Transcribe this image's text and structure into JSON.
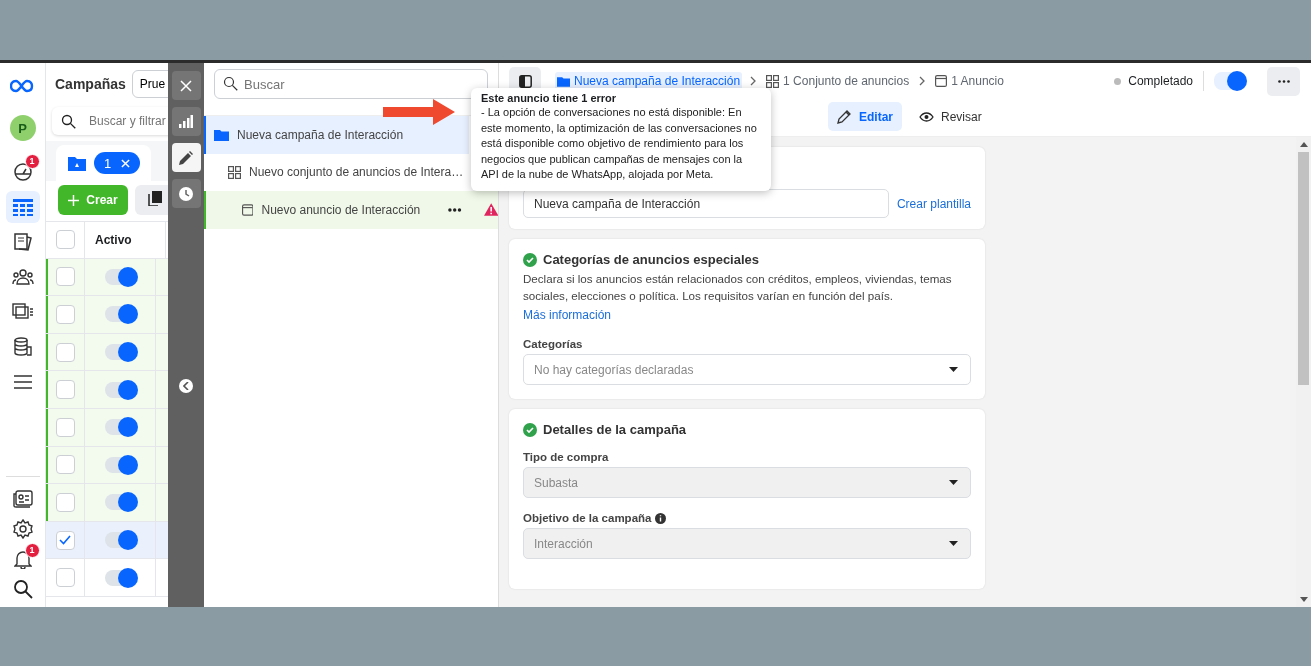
{
  "nav": {
    "avatar": "P",
    "items": [
      {
        "selected": false,
        "badge": "1"
      },
      {
        "selected": true
      },
      {
        "selected": false
      },
      {
        "selected": false
      },
      {
        "selected": false
      },
      {
        "selected": false
      },
      {
        "selected": false
      }
    ],
    "notifications_badge": "1"
  },
  "campaigns": {
    "title": "Campañas",
    "account_button": "Prue",
    "search_placeholder": "Buscar y filtrar",
    "filter_count": "1",
    "create_button": "Crear",
    "column": "Activo",
    "header_checked": false,
    "rows": [
      {
        "checked": false,
        "on": true,
        "highlighted": true
      },
      {
        "checked": false,
        "on": true,
        "highlighted": true
      },
      {
        "checked": false,
        "on": true,
        "highlighted": true
      },
      {
        "checked": false,
        "on": true,
        "highlighted": true
      },
      {
        "checked": false,
        "on": true,
        "highlighted": true
      },
      {
        "checked": false,
        "on": true,
        "highlighted": true
      },
      {
        "checked": false,
        "on": true,
        "highlighted": true
      },
      {
        "checked": true,
        "on": true,
        "highlighted": false
      },
      {
        "checked": false,
        "on": true,
        "highlighted": false
      }
    ]
  },
  "tools": [
    {
      "kind": "chart",
      "selected": false
    },
    {
      "kind": "edit",
      "selected": true
    },
    {
      "kind": "history",
      "selected": false
    }
  ],
  "tree": {
    "search_placeholder": "Buscar",
    "items": [
      {
        "label": "Nueva campaña de Interacción",
        "kind": "campaign",
        "selected": true,
        "highlighted": false,
        "error": false,
        "children": [
          {
            "label": "Nuevo conjunto de anuncios de Intera…",
            "kind": "ad_set",
            "selected": false,
            "highlighted": false,
            "error": false,
            "children": [
              {
                "label": "Nuevo anuncio de Interacción",
                "kind": "ad",
                "selected": false,
                "highlighted": true,
                "error": true
              }
            ]
          }
        ]
      }
    ]
  },
  "header": {
    "breadcrumbs": [
      {
        "label": "Nueva campaña de Interacción",
        "kind": "campaign",
        "selected": true
      },
      {
        "label": "1 Conjunto de anuncios",
        "kind": "ad_set",
        "selected": false
      },
      {
        "label": "1 Anuncio",
        "kind": "ad",
        "selected": false
      }
    ],
    "status": "Completado",
    "status_on": true,
    "tabs": [
      {
        "label": "Editar",
        "kind": "edit",
        "selected": true
      },
      {
        "label": "Revisar",
        "kind": "review",
        "selected": false
      }
    ]
  },
  "name_card": {
    "value": "Nueva campaña de Interacción",
    "link": "Crear plantilla"
  },
  "special_categories": {
    "title": "Categorías de anuncios especiales",
    "complete": true,
    "description": "Declara si los anuncios están relacionados con créditos, empleos, viviendas, temas sociales, elecciones o política. Los requisitos varían en función del país.",
    "link": "Más información",
    "field_label": "Categorías",
    "placeholder": "No hay categorías declaradas"
  },
  "details": {
    "title": "Detalles de la campaña",
    "complete": true,
    "fields": [
      {
        "label": "Tipo de compra",
        "value": "Subasta",
        "disabled": true,
        "info": false
      },
      {
        "label": "Objetivo de la campaña",
        "value": "Interacción",
        "disabled": true,
        "info": true
      }
    ]
  },
  "tooltip": {
    "title": "Este anuncio tiene 1 error",
    "text": "- La opción de conversaciones no está disponible: En este momento, la optimización de las conversaciones no está disponible como objetivo de rendimiento para los negocios que publican campañas de mensajes con la API de la nube de WhatsApp, alojada por Meta."
  }
}
